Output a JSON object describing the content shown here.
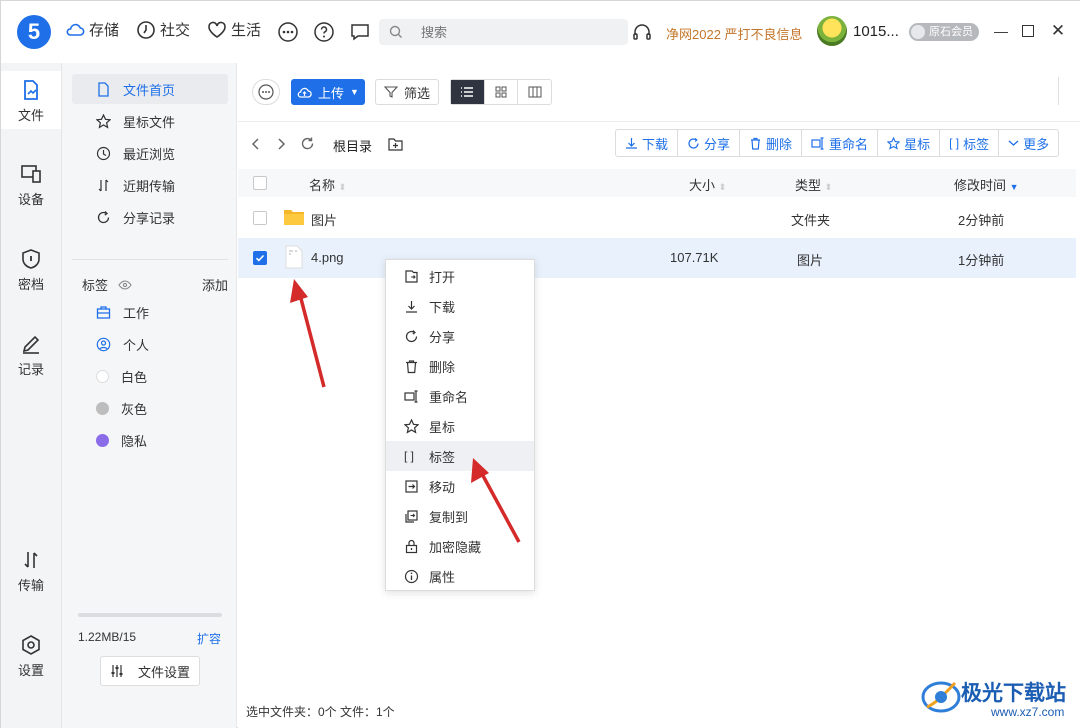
{
  "topbar": {
    "logo": "5",
    "nav": [
      {
        "label": "存储",
        "icon": "cloud-icon"
      },
      {
        "label": "社交",
        "icon": "clock-icon"
      },
      {
        "label": "生活",
        "icon": "heart-icon"
      }
    ],
    "search_placeholder": "搜索",
    "promo": "净网2022 严打不良信息",
    "username": "1015...",
    "vip_label": "原石会员"
  },
  "rail": [
    {
      "label": "文件",
      "icon": "file-icon"
    },
    {
      "label": "设备",
      "icon": "device-icon"
    },
    {
      "label": "密档",
      "icon": "shield-icon"
    },
    {
      "label": "记录",
      "icon": "pen-icon"
    },
    {
      "label": "传输",
      "icon": "transfer-icon"
    },
    {
      "label": "设置",
      "icon": "settings-icon"
    }
  ],
  "sidebar": {
    "items": [
      {
        "label": "文件首页",
        "icon": "doc-icon"
      },
      {
        "label": "星标文件",
        "icon": "star-icon"
      },
      {
        "label": "最近浏览",
        "icon": "history-icon"
      },
      {
        "label": "近期传输",
        "icon": "transfer-icon"
      },
      {
        "label": "分享记录",
        "icon": "share-icon"
      }
    ],
    "tags_title": "标签",
    "tags_add": "添加",
    "tags": [
      {
        "label": "工作",
        "icon": "briefcase-icon"
      },
      {
        "label": "个人",
        "icon": "person-icon"
      },
      {
        "label": "白色",
        "color": "#ffffff"
      },
      {
        "label": "灰色",
        "color": "#bdbdbd"
      },
      {
        "label": "隐私",
        "color": "#8b6ce8"
      }
    ],
    "storage_text": "1.22MB/15",
    "storage_fraction": 0.0,
    "expand": "扩容",
    "file_settings": "文件设置"
  },
  "toolbar": {
    "upload": "上传",
    "filter": "筛选"
  },
  "breadcrumb": "根目录",
  "actions": [
    {
      "label": "下载",
      "icon": "download-icon"
    },
    {
      "label": "分享",
      "icon": "share-icon"
    },
    {
      "label": "删除",
      "icon": "trash-icon"
    },
    {
      "label": "重命名",
      "icon": "rename-icon"
    },
    {
      "label": "星标",
      "icon": "star-icon"
    },
    {
      "label": "标签",
      "icon": "tag-icon"
    },
    {
      "label": "更多",
      "icon": "chevron-down-icon"
    }
  ],
  "table": {
    "headers": {
      "name": "名称",
      "size": "大小",
      "type": "类型",
      "modified": "修改时间"
    },
    "rows": [
      {
        "name": "图片",
        "size": "",
        "type": "文件夹",
        "modified": "2分钟前",
        "kind": "folder",
        "checked": false
      },
      {
        "name": "4.png",
        "size": "107.71K",
        "type": "图片",
        "modified": "1分钟前",
        "kind": "image",
        "checked": true
      }
    ]
  },
  "status_bar": "选中文件夹：0个 文件：1个",
  "context_menu": [
    {
      "label": "打开",
      "icon": "open-icon"
    },
    {
      "label": "下载",
      "icon": "download-icon"
    },
    {
      "label": "分享",
      "icon": "share-icon"
    },
    {
      "label": "删除",
      "icon": "trash-icon"
    },
    {
      "label": "重命名",
      "icon": "rename-icon"
    },
    {
      "label": "星标",
      "icon": "star-icon"
    },
    {
      "label": "标签",
      "icon": "tag-icon",
      "hover": true
    },
    {
      "label": "移动",
      "icon": "move-icon"
    },
    {
      "label": "复制到",
      "icon": "copy-icon"
    },
    {
      "label": "加密隐藏",
      "icon": "lock-icon"
    },
    {
      "label": "属性",
      "icon": "info-icon"
    }
  ],
  "watermark": {
    "text": "极光下载站",
    "url": "www.xz7.com"
  },
  "colors": {
    "accent": "#1e6fe8",
    "promo": "#c4762a",
    "arrow": "#d42a2a"
  }
}
